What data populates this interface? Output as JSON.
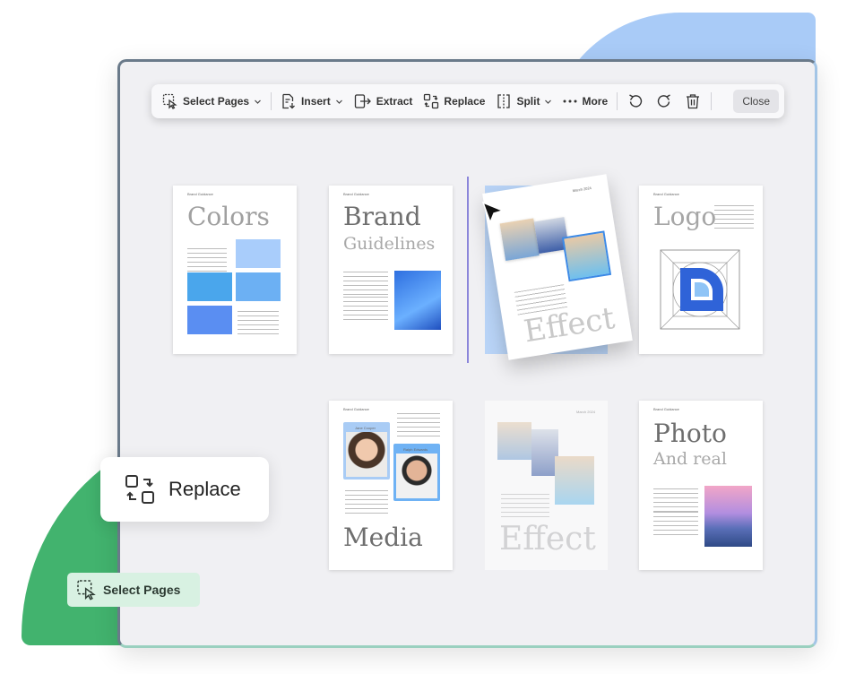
{
  "toolbar": {
    "select_pages": "Select Pages",
    "insert": "Insert",
    "extract": "Extract",
    "replace": "Replace",
    "split": "Split",
    "more": "More",
    "close": "Close"
  },
  "pages": {
    "colors": {
      "header": "Brand Guidance",
      "title": "Colors"
    },
    "brand": {
      "header": "Brand Guidance",
      "title": "Brand",
      "subtitle": "Guidelines"
    },
    "effect_dragged": {
      "date": "March 2024",
      "title": "Effect"
    },
    "logo": {
      "header": "Brand Guidance",
      "title": "Logo"
    },
    "media": {
      "header": "Brand Guidance",
      "title": "Media",
      "name1": "Jane Cooper",
      "name2": "Ralph Edwards"
    },
    "effect_ghost": {
      "date": "March 2024",
      "title": "Effect"
    },
    "photo": {
      "header": "Brand Guidance",
      "title": "Photo",
      "subtitle": "And real"
    }
  },
  "callout": {
    "label": "Replace"
  },
  "chip": {
    "label": "Select Pages"
  },
  "colors": {
    "green": "#42b36e",
    "blue": "#a9cbf7",
    "accent": "#8b86da"
  }
}
